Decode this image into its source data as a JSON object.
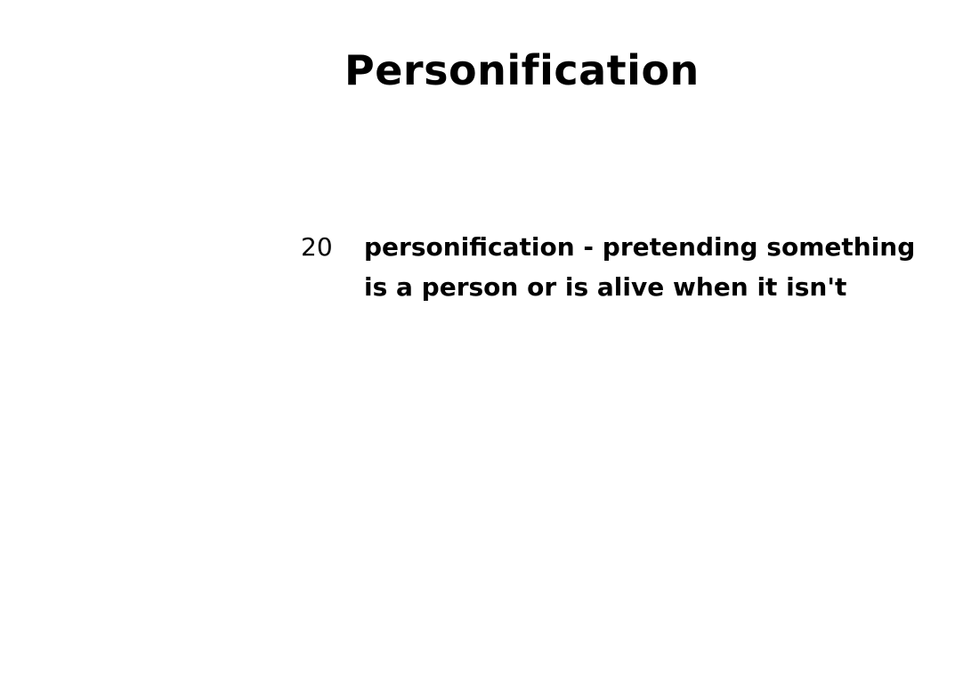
{
  "page": {
    "title": "Personification"
  },
  "entry": {
    "number": "20",
    "lines": [
      "personification - pretending something",
      "is a person or is alive when it isn't"
    ]
  }
}
